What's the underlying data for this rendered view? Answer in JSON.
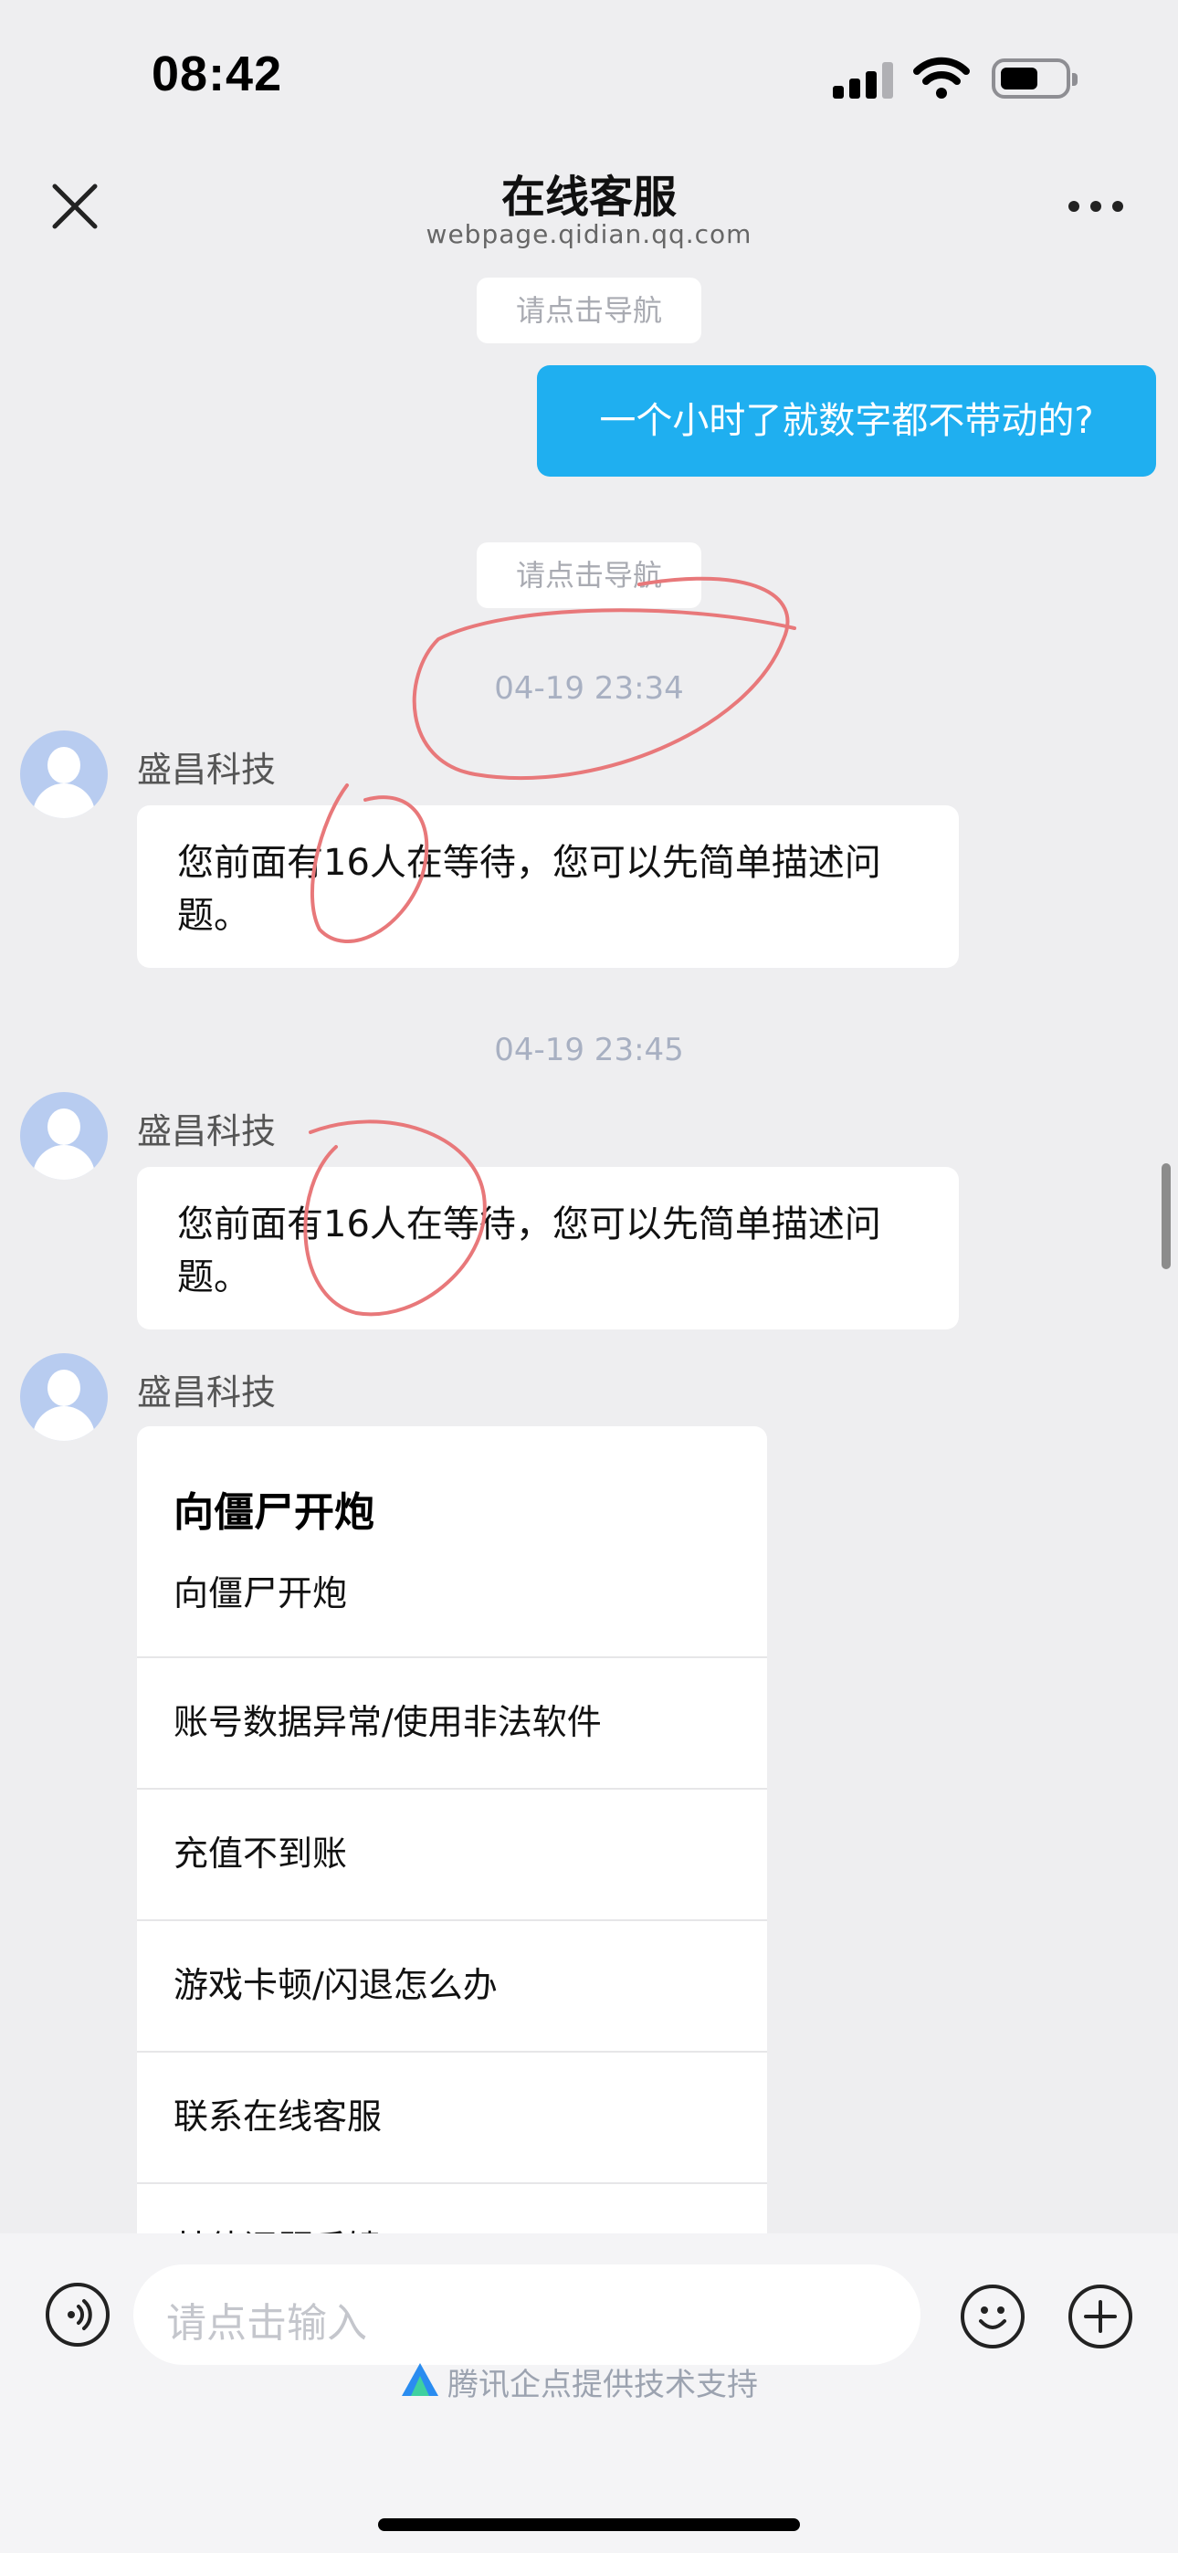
{
  "status_bar": {
    "time": "08:42",
    "signal_icon": "cellular-signal-icon",
    "wifi_icon": "wifi-icon",
    "battery_icon": "battery-icon"
  },
  "header": {
    "title": "在线客服",
    "subtitle": "webpage.qidian.qq.com",
    "close_icon": "close-icon",
    "more_icon": "more-dots-icon"
  },
  "chat": {
    "nav_hint_1": "请点击导航",
    "user_message": "一个小时了就数字都不带动的?",
    "nav_hint_2": "请点击导航",
    "timestamp_1": "04-19 23:34",
    "agent_name_1": "盛昌科技",
    "agent_message_1": "您前面有16人在等待，您可以先简单描述问题。",
    "timestamp_2": "04-19 23:45",
    "agent_name_2": "盛昌科技",
    "agent_message_2": "您前面有16人在等待，您可以先简单描述问题。",
    "agent_name_3": "盛昌科技",
    "menu": {
      "title": "向僵尸开炮",
      "subtitle": "向僵尸开炮",
      "items": [
        "账号数据异常/使用非法软件",
        "充值不到账",
        "游戏卡顿/闪退怎么办",
        "联系在线客服",
        "其他问题反馈"
      ]
    }
  },
  "input_bar": {
    "placeholder": "请点击输入",
    "voice_icon": "voice-icon",
    "emoji_icon": "emoji-icon",
    "plus_icon": "plus-icon"
  },
  "footer": {
    "powered_by": "腾讯企点提供技术支持",
    "logo_icon": "tencent-qidian-logo-icon"
  },
  "colors": {
    "accent": "#1faff0",
    "background": "#eeeef0",
    "annotation": "#e8787a"
  }
}
